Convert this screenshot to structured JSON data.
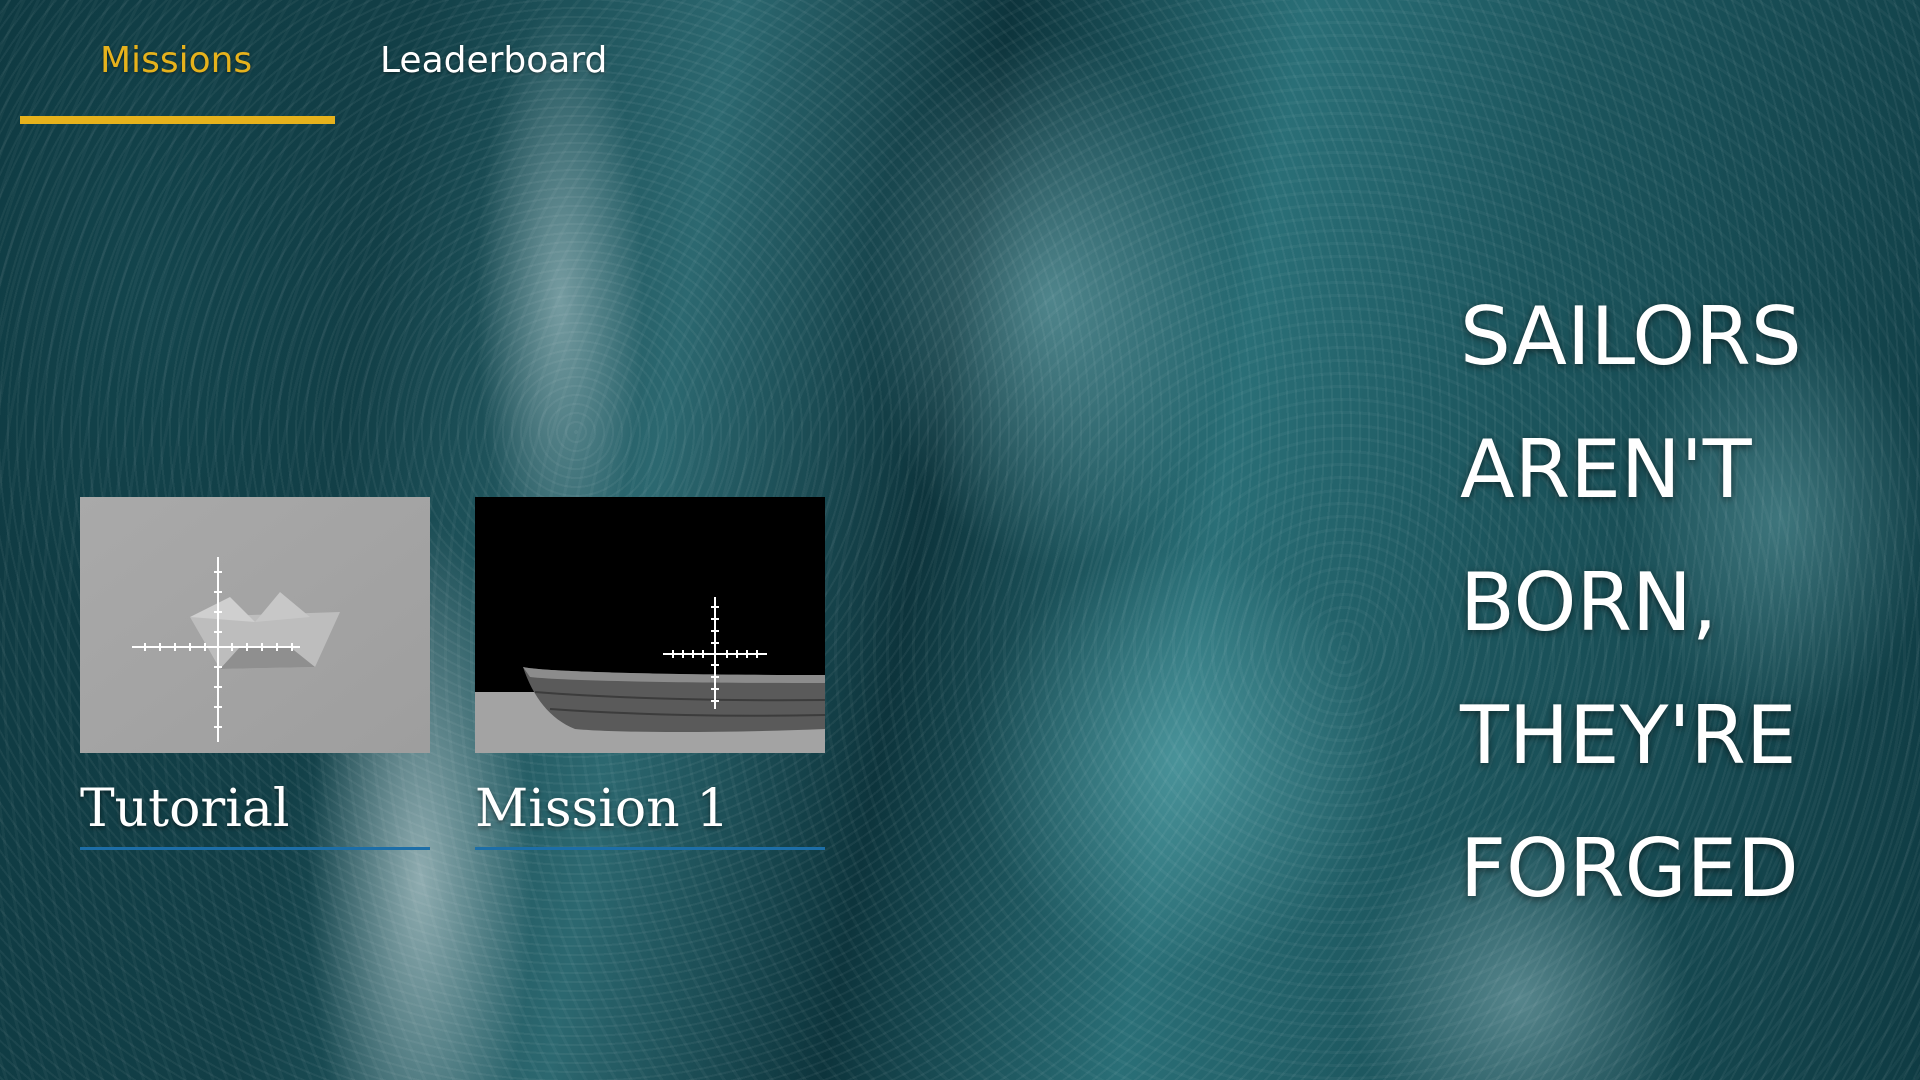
{
  "nav": {
    "tabs": [
      {
        "label": "Missions",
        "active": true
      },
      {
        "label": "Leaderboard",
        "active": false
      }
    ],
    "active_color": "#e6b21c"
  },
  "missions": [
    {
      "title": "Tutorial",
      "thumbnail": "paper-boat-crosshair-grey"
    },
    {
      "title": "Mission 1",
      "thumbnail": "wooden-boat-crosshair-dark"
    }
  ],
  "motto": {
    "lines": [
      "SAILORS",
      "AREN'T",
      "BORN,",
      "THEY'RE",
      "FORGED"
    ]
  },
  "colors": {
    "accent": "#e6b21c",
    "card_underline": "#1d6ea7",
    "ocean": "#0f3a42"
  }
}
